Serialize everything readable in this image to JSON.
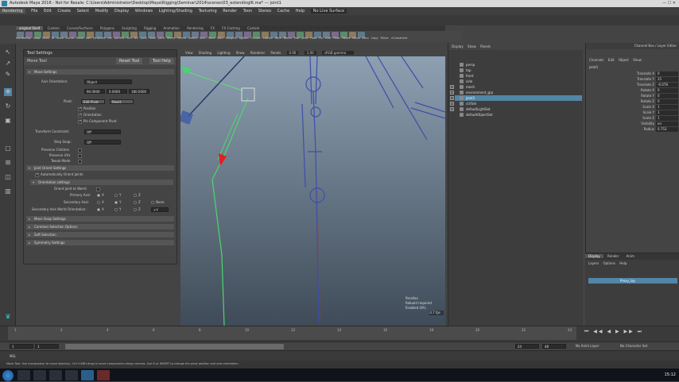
{
  "window": {
    "title": "Autodesk Maya 2016 - Not for Resale: C:\\Users\\Administrator\\Desktop\\Maya\\Rigging\\Seminar\\2014\\scenes\\03_extendingIK.ma* --- joint1",
    "controls": "—  ☐  ✕"
  },
  "menubar": {
    "mode": "Rendering",
    "items": [
      "File",
      "Edit",
      "Create",
      "Select",
      "Modify",
      "Display",
      "Windows",
      "Lighting/Shading",
      "Texturing",
      "Render",
      "Toon",
      "Stereo",
      "Cache",
      "Help"
    ],
    "live_surface": "No Live Surface"
  },
  "shelf": {
    "tabs": [
      "Custom",
      "Curves/Surfaces",
      "Polygons",
      "Sculpting",
      "Rigging",
      "Animation",
      "Rendering",
      "FX",
      "FX Caching",
      "Custom",
      "Arnold",
      "Bifrost",
      "MASH",
      "Motion Graphics",
      "XGen",
      "TURTLE"
    ],
    "active_tab": "original Shelf",
    "labels": [
      "mentalRay",
      "Loop",
      "Multi",
      "IK",
      "Save",
      "Curve",
      "Bone",
      "ikfk",
      "ikHandle",
      "ctrl",
      "jointFK",
      "Scn",
      "UV",
      "Lock",
      "Shell",
      "Joint",
      "Mirror",
      "Orient",
      "Select",
      "Skin",
      "Paint",
      "Skin",
      "Weights",
      "ngSkin",
      "Cluster",
      "Lattice",
      "Wire",
      "Blend",
      "Tool",
      "Joint",
      "Hold",
      "Fix",
      "Grid",
      "Pose",
      "Reset",
      "Move",
      "Zero",
      "Copy",
      "Mirror",
      "nConstraint"
    ]
  },
  "tool_settings": {
    "title": "Tool Settings",
    "tool_name": "Move Tool",
    "reset_label": "Reset Tool",
    "help_label": "Tool Help",
    "sections": {
      "move_settings": "Move Settings",
      "joint_orient": "Joint Orient Settings",
      "orientation": "Orientation settings",
      "snap": "Move Snap Settings",
      "common": "Common Selection Options",
      "soft": "Soft Selection",
      "symmetry": "Symmetry Settings"
    },
    "axis_orientation_label": "Axis Orientation:",
    "axis_orientation_value": "Object",
    "vector_values": [
      "90.0000",
      "0.0000",
      "180.0000"
    ],
    "pivot_label": "Pivot:",
    "edit_pivot": "Edit Pivot",
    "reset_pivot": "Reset",
    "pivot_checks": [
      "Position",
      "Orientation",
      "Pin Component Pivot"
    ],
    "transform_constraint_label": "Transform Constraint:",
    "transform_constraint_value": "Off",
    "step_snap_label": "Step Snap:",
    "step_snap_value": "Off",
    "preserve_children": "Preserve Children",
    "preserve_uvs": "Preserve UVs",
    "tweak_mode": "Tweak Mode",
    "auto_orient": "Automatically Orient Joints",
    "orient_world": "Orient Joint to World",
    "primary_axis": "Primary Axis:",
    "secondary_axis": "Secondary Axis:",
    "secondary_world": "Secondary Axis World Orientation:",
    "axes": [
      "X",
      "Y",
      "Z"
    ],
    "none_label": "None",
    "plus_label": "+Y"
  },
  "viewport": {
    "toolbar": [
      "View",
      "Shading",
      "Lighting",
      "Show",
      "Renderer",
      "Panels"
    ],
    "field1": "0.00",
    "field2": "1.00",
    "color_space": "sRGB gamma",
    "hud": [
      "Parallax",
      "Rebuild required",
      "Enabled (0h)"
    ],
    "fps": "4.7 fps"
  },
  "outliner": {
    "menu": [
      "Display",
      "Show",
      "Panels"
    ],
    "items": [
      {
        "label": "persp",
        "type": "camera",
        "expand": false,
        "selected": false
      },
      {
        "label": "top",
        "type": "camera",
        "expand": false,
        "selected": false
      },
      {
        "label": "front",
        "type": "camera",
        "expand": false,
        "selected": false
      },
      {
        "label": "side",
        "type": "camera",
        "expand": false,
        "selected": false
      },
      {
        "label": "mesh",
        "type": "mesh",
        "expand": true,
        "selected": false
      },
      {
        "label": "environment_grp",
        "type": "group",
        "expand": true,
        "selected": false
      },
      {
        "label": "joint1",
        "type": "joint",
        "expand": true,
        "selected": true
      },
      {
        "label": "ctrlSet",
        "type": "set",
        "expand": true,
        "selected": false
      },
      {
        "label": "defaultLightSet",
        "type": "set",
        "expand": true,
        "selected": false
      },
      {
        "label": "defaultObjectSet",
        "type": "set",
        "expand": false,
        "selected": false
      }
    ]
  },
  "channel_box": {
    "title": "Channel Box / Layer Editor",
    "menu": [
      "Channels",
      "Edit",
      "Object",
      "Show"
    ],
    "node": "joint1",
    "attributes": [
      {
        "name": "Translate X",
        "value": "0"
      },
      {
        "name": "Translate Y",
        "value": "25"
      },
      {
        "name": "Translate Z",
        "value": "-0.078"
      },
      {
        "name": "Rotate X",
        "value": "0"
      },
      {
        "name": "Rotate Y",
        "value": "0"
      },
      {
        "name": "Rotate Z",
        "value": "0"
      },
      {
        "name": "Scale X",
        "value": "1"
      },
      {
        "name": "Scale Y",
        "value": "1"
      },
      {
        "name": "Scale Z",
        "value": "1"
      },
      {
        "name": "Visibility",
        "value": "on"
      },
      {
        "name": "Radius",
        "value": "0.753"
      }
    ]
  },
  "layer_editor": {
    "tabs": [
      "Display",
      "Render",
      "Anim"
    ],
    "menu": [
      "Layers",
      "Options",
      "Help"
    ],
    "layer": "Proxy_lay"
  },
  "timeline": {
    "ticks": [
      "1",
      "2",
      "4",
      "6",
      "8",
      "10",
      "12",
      "14",
      "16",
      "18",
      "20",
      "22",
      "24"
    ],
    "current_frame": "1"
  },
  "range": {
    "start": "1",
    "inner_start": "1",
    "inner_end": "24",
    "end": "24",
    "max": "48",
    "anim_layer": "No Anim Layer",
    "char_set": "No Character Set"
  },
  "cmdline": {
    "label": "MEL"
  },
  "help_line": "Move Tool: Use manipulator to move object(s). Ctrl+LMB+drag to move components along normals. Use D or INSERT to change the pivot position and axis orientation.",
  "taskbar": {
    "time": "15:12"
  }
}
